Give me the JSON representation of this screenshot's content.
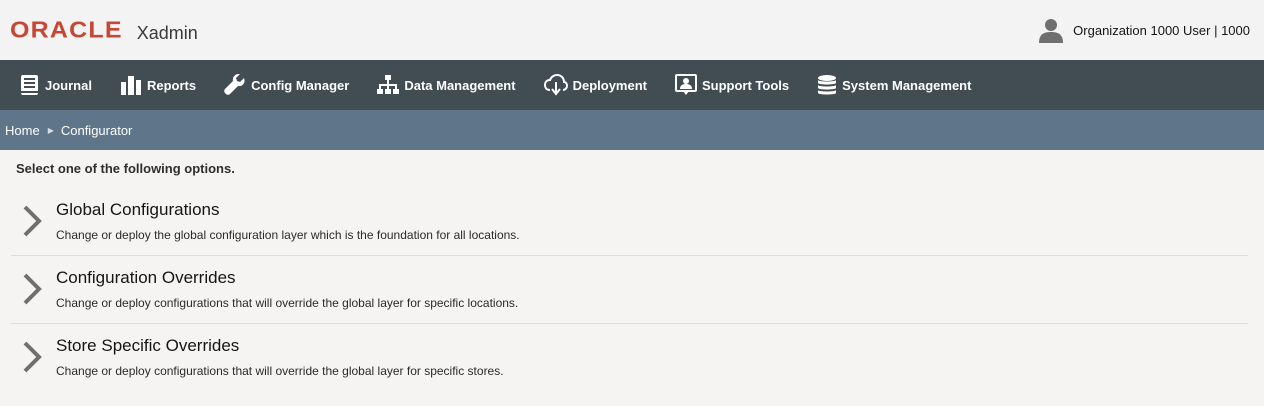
{
  "header": {
    "logo_text": "ORACLE",
    "app_name": "Xadmin",
    "user_label": "Organization 1000 User | 1000"
  },
  "nav": {
    "items": [
      {
        "label": "Journal",
        "icon": "journal-icon"
      },
      {
        "label": "Reports",
        "icon": "reports-icon"
      },
      {
        "label": "Config Manager",
        "icon": "wrench-icon"
      },
      {
        "label": "Data Management",
        "icon": "hierarchy-icon"
      },
      {
        "label": "Deployment",
        "icon": "cloud-download-icon"
      },
      {
        "label": "Support Tools",
        "icon": "support-icon"
      },
      {
        "label": "System Management",
        "icon": "database-icon"
      }
    ]
  },
  "breadcrumb": {
    "home": "Home",
    "current": "Configurator"
  },
  "content": {
    "instructions": "Select one of the following options.",
    "options": [
      {
        "title": "Global Configurations",
        "description": "Change or deploy the global configuration layer which is the foundation for all locations."
      },
      {
        "title": "Configuration Overrides",
        "description": "Change or deploy configurations that will override the global layer for specific locations."
      },
      {
        "title": "Store Specific Overrides",
        "description": "Change or deploy configurations that will override the global layer for specific stores."
      }
    ]
  },
  "colors": {
    "brand_red": "#c74634",
    "nav_bg": "#414c53",
    "breadcrumb_bg": "#5f7589"
  }
}
